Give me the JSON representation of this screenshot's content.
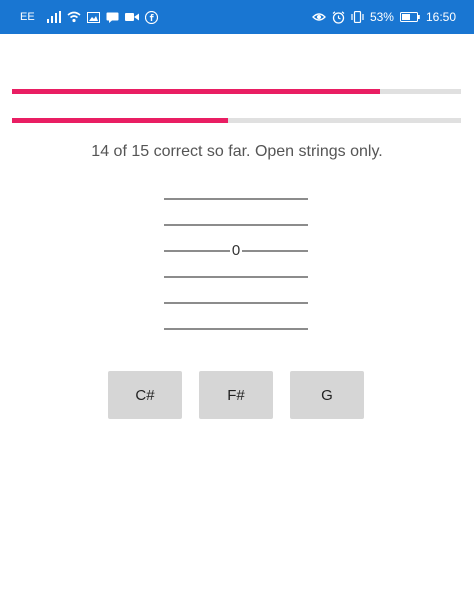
{
  "status_bar": {
    "carrier": "EE",
    "battery_percent": "53%",
    "time": "16:50",
    "icons_left": [
      "signal-icon",
      "wifi-icon",
      "image-icon",
      "message-icon",
      "video-icon",
      "facebook-icon"
    ],
    "icons_right": [
      "eye-icon",
      "alarm-icon",
      "vibrate-icon",
      "battery-icon"
    ],
    "color": "#1976d2"
  },
  "progress": {
    "overall_fraction": 0.82,
    "secondary_fraction": 0.48,
    "fill_color": "#e91e63",
    "track_color": "#e0e0e0"
  },
  "quiz": {
    "status_text": "14 of 15 correct so far. Open strings only.",
    "tab": {
      "string_count": 6,
      "note_string_index": 2,
      "fret": "0"
    },
    "answers": [
      {
        "label": "C#"
      },
      {
        "label": "F#"
      },
      {
        "label": "G"
      }
    ]
  }
}
